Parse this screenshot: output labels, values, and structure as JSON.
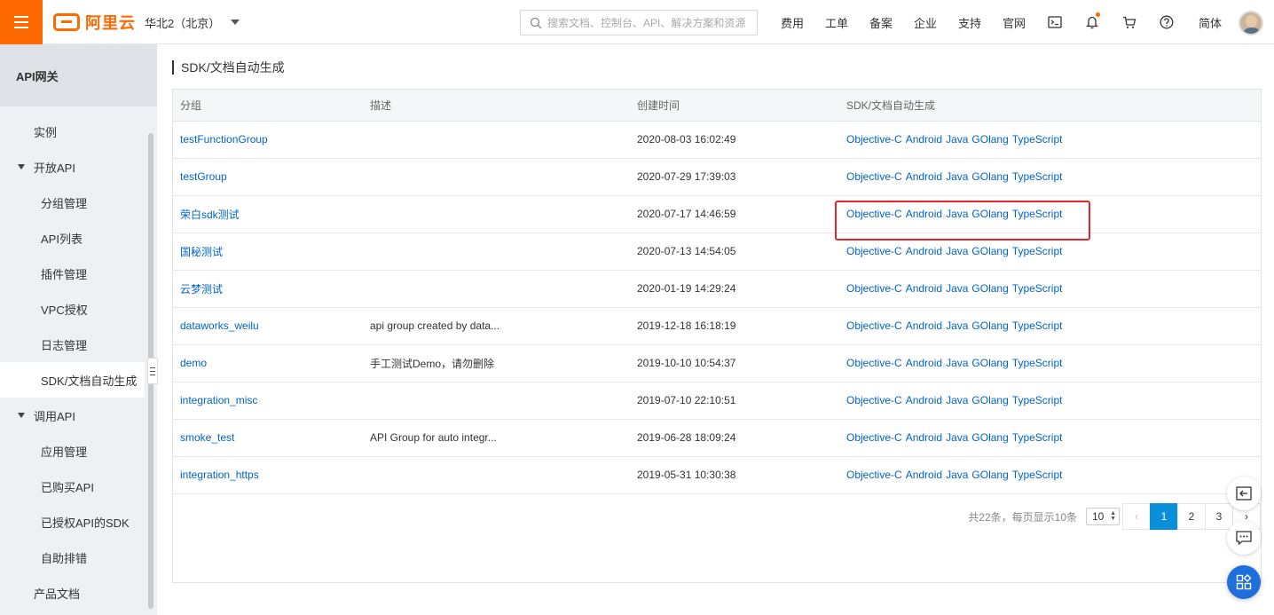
{
  "topbar": {
    "brand": "阿里云",
    "region": "华北2（北京）",
    "search_placeholder": "搜索文档、控制台、API、解决方案和资源",
    "nav": [
      "费用",
      "工单",
      "备案",
      "企业",
      "支持",
      "官网"
    ],
    "lang": "简体",
    "icons": [
      "terminal-icon",
      "bell-icon",
      "cart-icon",
      "help-icon"
    ]
  },
  "sidebar": {
    "title": "API网关",
    "items": [
      {
        "label": "实例"
      },
      {
        "label": "开放API"
      },
      {
        "label": "分组管理"
      },
      {
        "label": "API列表"
      },
      {
        "label": "插件管理"
      },
      {
        "label": "VPC授权"
      },
      {
        "label": "日志管理"
      },
      {
        "label": "SDK/文档自动生成"
      },
      {
        "label": "调用API"
      },
      {
        "label": "应用管理"
      },
      {
        "label": "已购买API"
      },
      {
        "label": "已授权API的SDK"
      },
      {
        "label": "自助排错"
      },
      {
        "label": "产品文档"
      }
    ]
  },
  "main": {
    "title": "SDK/文档自动生成",
    "table": {
      "columns": [
        "分组",
        "描述",
        "创建时间",
        "SDK/文档自动生成"
      ],
      "rows": [
        {
          "group": "testFunctionGroup",
          "desc": "",
          "time": "2020-08-03 16:02:49"
        },
        {
          "group": "testGroup",
          "desc": "",
          "time": "2020-07-29 17:39:03"
        },
        {
          "group": "荣白sdk测试",
          "desc": "",
          "time": "2020-07-17 14:46:59"
        },
        {
          "group": "国秘测试",
          "desc": "",
          "time": "2020-07-13 14:54:05"
        },
        {
          "group": "云梦测试",
          "desc": "",
          "time": "2020-01-19 14:29:24"
        },
        {
          "group": "dataworks_weilu",
          "desc": "api group created by data...",
          "time": "2019-12-18 16:18:19"
        },
        {
          "group": "demo",
          "desc": "手工测试Demo，请勿删除",
          "time": "2019-10-10 10:54:37"
        },
        {
          "group": "integration_misc",
          "desc": "",
          "time": "2019-07-10 22:10:51"
        },
        {
          "group": "smoke_test",
          "desc": "API Group for auto integr...",
          "time": "2019-06-28 18:09:24"
        },
        {
          "group": "integration_https",
          "desc": "",
          "time": "2019-05-31 10:30:38"
        }
      ],
      "sdk_links": [
        "Objective-C",
        "Android",
        "Java",
        "GOlang",
        "TypeScript"
      ]
    },
    "pager": {
      "info": "共22条，每页显示10条",
      "page_size": "10",
      "prev": "‹",
      "pages": [
        "1",
        "2",
        "3"
      ],
      "next": "›",
      "current": "1"
    }
  },
  "colors": {
    "brand": "#ff6a00",
    "link": "#0064c8",
    "active_page": "#0a8fd9",
    "highlight": "#e0262c"
  }
}
